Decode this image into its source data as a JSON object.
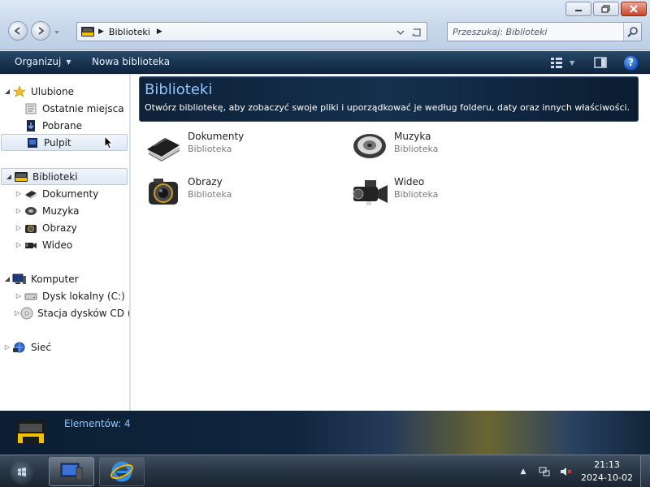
{
  "window": {
    "controls": [
      "minimize",
      "maximize",
      "close"
    ]
  },
  "address_bar": {
    "path": "Biblioteki",
    "icon": "libraries-icon"
  },
  "search": {
    "placeholder": "Przeszukaj: Biblioteki"
  },
  "toolbar": {
    "organize_label": "Organizuj",
    "new_library_label": "Nowa biblioteka",
    "help_label": "?"
  },
  "navigation": {
    "favorites": {
      "label": "Ulubione",
      "items": [
        {
          "label": "Ostatnie miejsca",
          "icon": "recent-places-icon"
        },
        {
          "label": "Pobrane",
          "icon": "downloads-icon"
        },
        {
          "label": "Pulpit",
          "icon": "desktop-icon",
          "selected": true
        }
      ]
    },
    "libraries": {
      "label": "Biblioteki",
      "items": [
        {
          "label": "Dokumenty",
          "icon": "documents-icon"
        },
        {
          "label": "Muzyka",
          "icon": "music-icon"
        },
        {
          "label": "Obrazy",
          "icon": "pictures-icon"
        },
        {
          "label": "Wideo",
          "icon": "video-icon"
        }
      ]
    },
    "computer": {
      "label": "Komputer",
      "items": [
        {
          "label": "Dysk lokalny (C:)",
          "icon": "local-disk-icon"
        },
        {
          "label": "Stacja dysków CD (D",
          "icon": "cd-drive-icon"
        }
      ]
    },
    "network": {
      "label": "Sieć",
      "icon": "network-icon"
    }
  },
  "content": {
    "title": "Biblioteki",
    "subtitle": "Otwórz bibliotekę, aby zobaczyć swoje pliki i uporządkować je według folderu, daty oraz innych właściwości.",
    "libraries": [
      {
        "name": "Dokumenty",
        "type": "Biblioteka",
        "icon": "documents-library-icon"
      },
      {
        "name": "Muzyka",
        "type": "Biblioteka",
        "icon": "music-library-icon"
      },
      {
        "name": "Obrazy",
        "type": "Biblioteka",
        "icon": "pictures-library-icon"
      },
      {
        "name": "Wideo",
        "type": "Biblioteka",
        "icon": "video-library-icon"
      }
    ]
  },
  "details": {
    "item_count": "Elementów: 4"
  },
  "taskbar": {
    "apps": [
      "windows-explorer-icon",
      "internet-explorer-icon"
    ],
    "clock_time": "21:13",
    "clock_date": "2024-10-02"
  },
  "colors": {
    "header_title": "#8fc6ff",
    "toolbar_bg": "#1a3552",
    "selection_bg": "#dde8f5"
  }
}
